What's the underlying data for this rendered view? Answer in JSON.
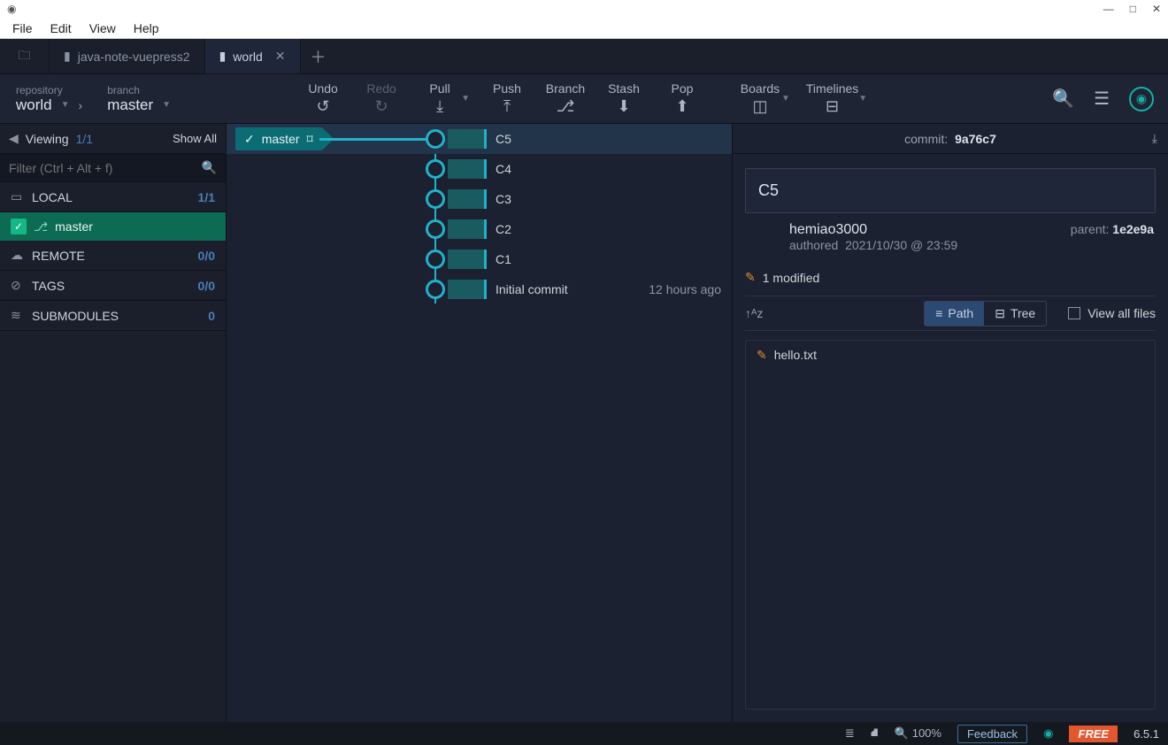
{
  "menubar": [
    "File",
    "Edit",
    "View",
    "Help"
  ],
  "tabs": [
    {
      "label": "java-note-vuepress2",
      "active": false
    },
    {
      "label": "world",
      "active": true
    }
  ],
  "toolbar": {
    "repo_label": "repository",
    "repo_value": "world",
    "branch_label": "branch",
    "branch_value": "master",
    "actions": [
      {
        "name": "undo",
        "label": "Undo",
        "glyph": "↺",
        "dim": false
      },
      {
        "name": "redo",
        "label": "Redo",
        "glyph": "↻",
        "dim": true
      },
      {
        "name": "pull",
        "label": "Pull",
        "glyph": "⤓",
        "dd": true
      },
      {
        "name": "push",
        "label": "Push",
        "glyph": "⤒"
      },
      {
        "name": "branch",
        "label": "Branch",
        "glyph": "⎇"
      },
      {
        "name": "stash",
        "label": "Stash",
        "glyph": "⬇"
      },
      {
        "name": "pop",
        "label": "Pop",
        "glyph": "⬆"
      }
    ],
    "boards_label": "Boards",
    "timelines_label": "Timelines"
  },
  "sidebar": {
    "viewing": "Viewing",
    "viewing_count": "1/1",
    "show_all": "Show All",
    "filter_placeholder": "Filter (Ctrl + Alt + f)",
    "sections": [
      {
        "icon": "▭",
        "label": "LOCAL",
        "count": "1/1"
      },
      {
        "icon": "☁",
        "label": "REMOTE",
        "count": "0/0"
      },
      {
        "icon": "⊘",
        "label": "TAGS",
        "count": "0/0"
      },
      {
        "icon": "≋",
        "label": "SUBMODULES",
        "count": "0"
      }
    ],
    "branch_item": "master"
  },
  "graph": {
    "branch_pill": "master",
    "commits": [
      {
        "msg": "C5",
        "selected": true
      },
      {
        "msg": "C4"
      },
      {
        "msg": "C3"
      },
      {
        "msg": "C2"
      },
      {
        "msg": "C1"
      },
      {
        "msg": "Initial commit",
        "time": "12 hours ago"
      }
    ]
  },
  "panel": {
    "commit_label": "commit:",
    "commit_hash": "9a76c7",
    "message": "C5",
    "author": "hemiao3000",
    "authored_label": "authored",
    "authored_date": "2021/10/30 @ 23:59",
    "parent_label": "parent:",
    "parent_hash": "1e2e9a",
    "modified": "1 modified",
    "path_label": "Path",
    "tree_label": "Tree",
    "view_all": "View all files",
    "files": [
      {
        "name": "hello.txt"
      }
    ]
  },
  "status": {
    "zoom": "100%",
    "feedback": "Feedback",
    "plan": "FREE",
    "version": "6.5.1"
  }
}
